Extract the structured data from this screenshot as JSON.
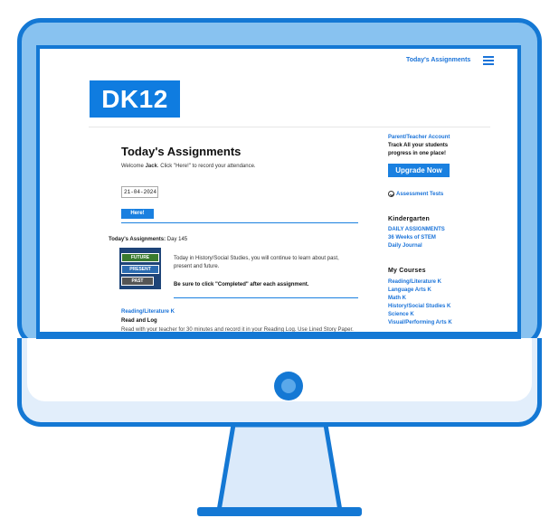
{
  "colors": {
    "accent": "#1a80e0",
    "frame": "#1478d4",
    "bezel": "#88c2f0"
  },
  "topbar": {
    "nav_link": "Today's Assignments",
    "menu_icon": "hamburger-menu-icon"
  },
  "logo": {
    "text": "DK12"
  },
  "main": {
    "title": "Today's Assignments",
    "welcome_prefix": "Welcome ",
    "welcome_name": "Jack",
    "welcome_suffix": ". Click \"Here!\" to record your attendance.",
    "date_value": "21-04-2024",
    "here_button": "Here!",
    "day_label": "Today's Assignments:",
    "day_value": " Day 145",
    "image_signs": [
      "FUTURE",
      "PRESENT",
      "PAST"
    ],
    "lesson_text": "Today in History/Social Studies, you will continue to learn about past, present and future.",
    "lesson_note": "Be sure to click \"Completed\" after each assignment.",
    "course_link": "Reading/Literature K",
    "task_title": "Read and Log",
    "task_text": "Read with your teacher for 30 minutes and record it in your Reading Log. Use Lined Story Paper."
  },
  "sidebar": {
    "account_link": "Parent/Teacher Account",
    "promo_line1": "Track All your students",
    "promo_line2": "progress in one place!",
    "upgrade_button": "Upgrade Now",
    "assessment_link": "Assessment Tests",
    "grade_heading": "Kindergarten",
    "grade_links": [
      "DAILY ASSIGNMENTS",
      "36 Weeks of STEM",
      "Daily Journal"
    ],
    "courses_heading": "My Courses",
    "course_links": [
      "Reading/Literature K",
      "Language Arts K",
      "Math K",
      "History/Social Studies K",
      "Science K",
      "Visual/Performing Arts K"
    ]
  }
}
